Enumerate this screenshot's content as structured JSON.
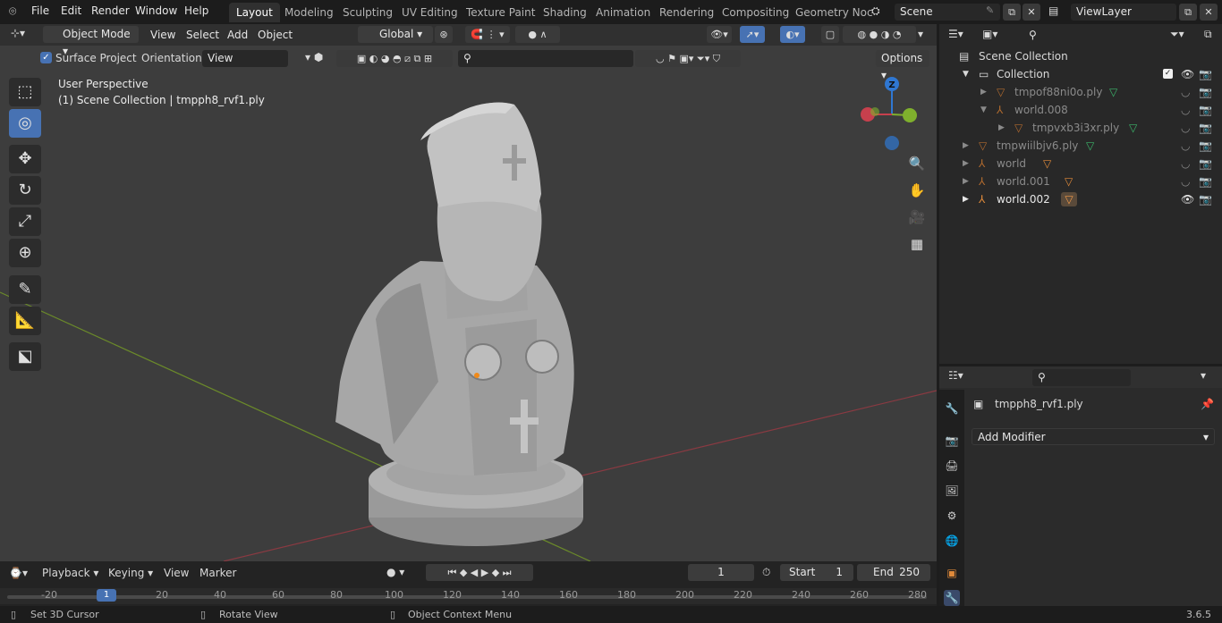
{
  "topbar": {
    "menus": [
      "File",
      "Edit",
      "Render",
      "Window",
      "Help"
    ],
    "workspaces": [
      "Layout",
      "Modeling",
      "Sculpting",
      "UV Editing",
      "Texture Paint",
      "Shading",
      "Animation",
      "Rendering",
      "Compositing",
      "Geometry Noc"
    ],
    "scene": "Scene",
    "view_layer": "ViewLayer"
  },
  "viewport_header": {
    "mode": "Object Mode",
    "menus": [
      "View",
      "Select",
      "Add",
      "Object"
    ],
    "orientation_global": "Global",
    "surface_project": "Surface Project",
    "orientation_label": "Orientation:",
    "orientation_value": "View",
    "options": "Options"
  },
  "viewport": {
    "perspective": "User Perspective",
    "collection_info": "(1) Scene Collection | tmpph8_rvf1.ply",
    "gizmo_z": "Z",
    "gizmo_y": "Y",
    "gizmo_x": "X"
  },
  "timeline": {
    "menus": [
      "Playback",
      "Keying",
      "View",
      "Marker"
    ],
    "current_frame": "1",
    "start_label": "Start",
    "start_value": "1",
    "end_label": "End",
    "end_value": "250",
    "ruler": [
      "-20",
      "1",
      "20",
      "40",
      "60",
      "80",
      "100",
      "120",
      "140",
      "160",
      "180",
      "200",
      "220",
      "240",
      "260",
      "280"
    ]
  },
  "status": {
    "left": "Set 3D Cursor",
    "middle": "Rotate View",
    "right": "Object Context Menu",
    "version": "3.6.5"
  },
  "outliner": {
    "root": "Scene Collection",
    "rows": [
      {
        "label": "Collection",
        "indent": 1,
        "type": "collection"
      },
      {
        "label": "tmpof88ni0o.ply",
        "indent": 2,
        "type": "mesh",
        "dim": true
      },
      {
        "label": "world.008",
        "indent": 2,
        "type": "empty",
        "dim": true
      },
      {
        "label": "tmpvxb3i3xr.ply",
        "indent": 3,
        "type": "mesh",
        "dim": true
      },
      {
        "label": "tmpwiilbjv6.ply",
        "indent": 1,
        "type": "mesh",
        "dim": true
      },
      {
        "label": "world",
        "indent": 1,
        "type": "empty",
        "dim": true
      },
      {
        "label": "world.001",
        "indent": 1,
        "type": "empty",
        "dim": true
      },
      {
        "label": "world.002",
        "indent": 1,
        "type": "empty",
        "dim": false
      }
    ]
  },
  "properties": {
    "object_name": "tmpph8_rvf1.ply",
    "add_modifier": "Add Modifier"
  },
  "colors": {
    "accent": "#4772b3",
    "x_axis": "#c7404d",
    "y_axis": "#7fb02d",
    "z_axis": "#2f77d2"
  }
}
